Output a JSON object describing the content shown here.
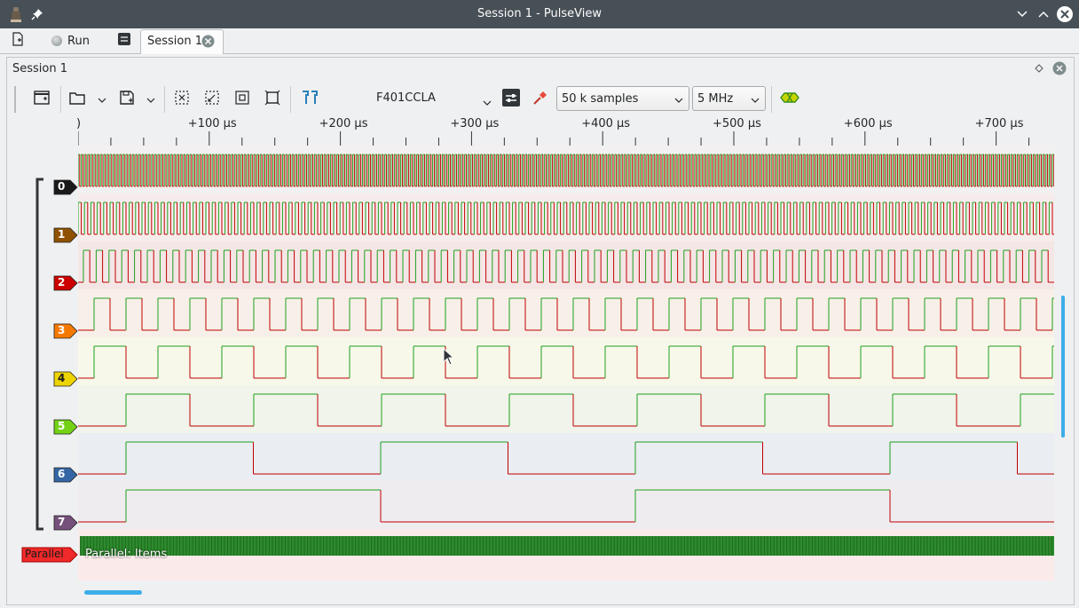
{
  "window": {
    "title": "Session 1 - PulseView"
  },
  "tabbar": {
    "run_label": "Run",
    "session_tab_label": "Session 1"
  },
  "panel": {
    "title": "Session 1"
  },
  "toolbar": {
    "device": "F401CCLA",
    "samples": "50 k samples",
    "samplerate": "5 MHz"
  },
  "ruler": {
    "ticks": [
      ")",
      "+100 µs",
      "+200 µs",
      "+300 µs",
      "+400 µs",
      "+500 µs",
      "+600 µs",
      "+700 µs"
    ]
  },
  "channels": [
    {
      "name": "0",
      "color": "#1a1a1a",
      "bg": "#f2f0f0"
    },
    {
      "name": "1",
      "color": "#8f5202",
      "bg": "#f7ecec"
    },
    {
      "name": "2",
      "color": "#cc0000",
      "bg": "#f5e6e6"
    },
    {
      "name": "3",
      "color": "#f57900",
      "bg": "#f8f0e8"
    },
    {
      "name": "4",
      "color": "#edd400",
      "bg": "#f8f8ea"
    },
    {
      "name": "5",
      "color": "#73d216",
      "bg": "#f0f4ea"
    },
    {
      "name": "6",
      "color": "#3465a4",
      "bg": "#eaedf2"
    },
    {
      "name": "7",
      "color": "#75507b",
      "bg": "#efecef"
    }
  ],
  "decoder": {
    "label": "Parallel",
    "row_text": "Parallel: Items",
    "color": "#ef2929"
  },
  "colors": {
    "high": "#1ea01e",
    "low": "#c00000",
    "accent": "#3daee9"
  }
}
